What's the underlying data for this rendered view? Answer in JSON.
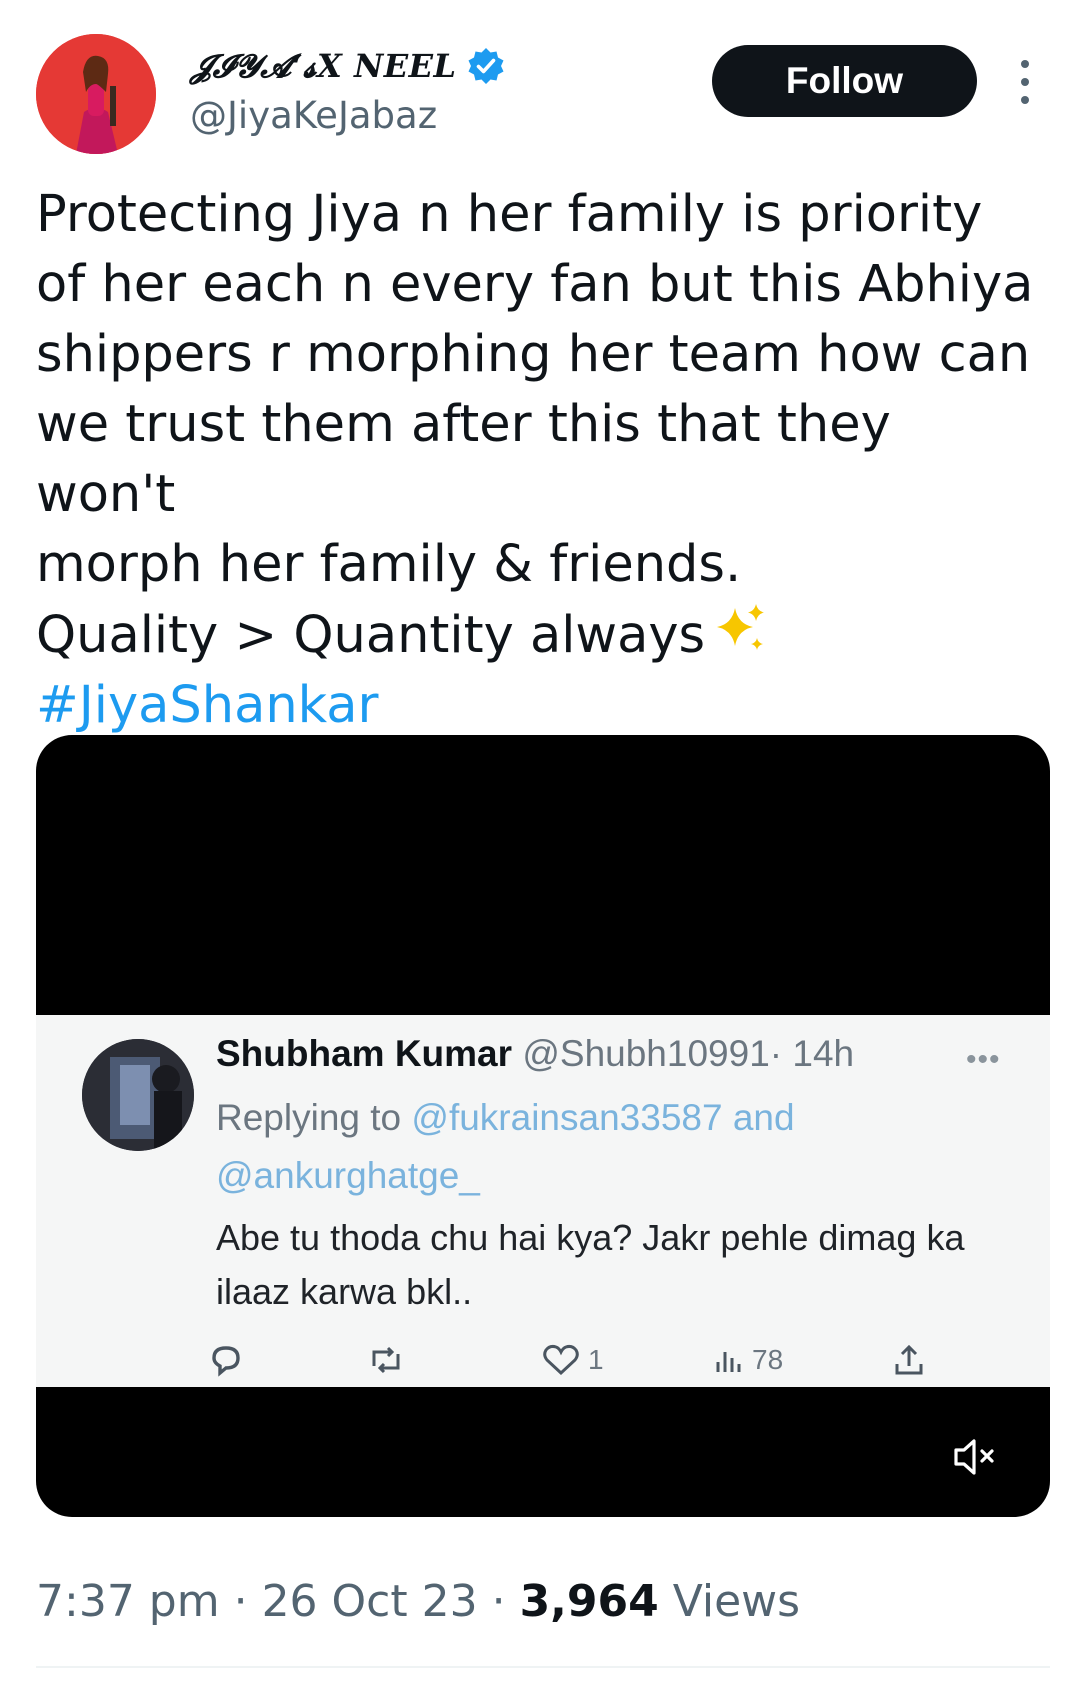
{
  "author": {
    "display_name": "𝓙𝓘𝓨𝓐‘𝓼X NEEL",
    "handle": "@JiyaKeJabaz",
    "verified_icon": "verified-badge-icon",
    "avatar_bg": "#e53935"
  },
  "follow_label": "Follow",
  "tweet": {
    "lines": [
      "Protecting Jiya n her family is priority",
      "of her each n every fan but this Abhiya",
      "shippers r morphing her team how can",
      "we trust them after this that they won't",
      "morph her family & friends."
    ],
    "quality_line": "Quality > Quantity always",
    "hashtag": "#JiyaShankar",
    "hashtag_color": "#1d9bf0"
  },
  "embedded": {
    "name": "Shubham Kumar",
    "handle": "@Shubh10991",
    "time": "· 14h",
    "replying_prefix": "Replying to",
    "mention1": "@fukrainsan33587",
    "and": "and",
    "mention2": "@ankurghatge_",
    "body": "Abe tu thoda chu hai kya? Jakr pehle dimag ka ilaaz karwa bkl..",
    "likes": "1",
    "views": "78"
  },
  "meta": {
    "time": "7:37 pm",
    "sep1": " · ",
    "date": "26 Oct 23",
    "sep2": " · ",
    "views_count": "3,964",
    "views_label": " Views"
  }
}
